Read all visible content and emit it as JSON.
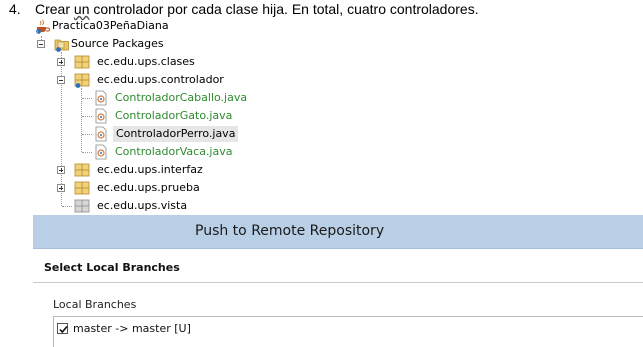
{
  "instruction": {
    "number": "4.",
    "text_before": "Crear ",
    "text_underlined": "un",
    "text_after": " controlador por cada clase hija. En total, cuatro controladores."
  },
  "tree": {
    "project": {
      "label": "Practica03PeñaDiana",
      "icon": "java-project-icon"
    },
    "source_packages": {
      "label": "Source Packages",
      "icon": "source-folder-icon",
      "expanded": true
    },
    "packages": [
      {
        "label": "ec.edu.ups.clases",
        "expanded": false,
        "icon": "package-icon"
      },
      {
        "label": "ec.edu.ups.controlador",
        "expanded": true,
        "icon": "package-icon",
        "files": [
          {
            "label": "ControladorCaballo.java",
            "icon": "java-file-icon",
            "color": "#2e8b2e",
            "selected": false
          },
          {
            "label": "ControladorGato.java",
            "icon": "java-file-icon",
            "color": "#2e8b2e",
            "selected": false
          },
          {
            "label": "ControladorPerro.java",
            "icon": "java-file-icon",
            "color": "#111111",
            "selected": true
          },
          {
            "label": "ControladorVaca.java",
            "icon": "java-file-icon",
            "color": "#2e8b2e",
            "selected": false
          }
        ]
      },
      {
        "label": "ec.edu.ups.interfaz",
        "expanded": false,
        "icon": "package-icon"
      },
      {
        "label": "ec.edu.ups.prueba",
        "expanded": false,
        "icon": "package-icon"
      },
      {
        "label": "ec.edu.ups.vista",
        "expanded": false,
        "icon": "empty-package-icon"
      }
    ]
  },
  "dialog": {
    "title": "Push to Remote Repository",
    "section_title": "Select Local Branches",
    "local_branches_label": "Local Branches",
    "branches": [
      {
        "label": "master -> master [U]",
        "checked": true
      }
    ],
    "colors": {
      "title_bar": "#b9cfe6"
    }
  }
}
